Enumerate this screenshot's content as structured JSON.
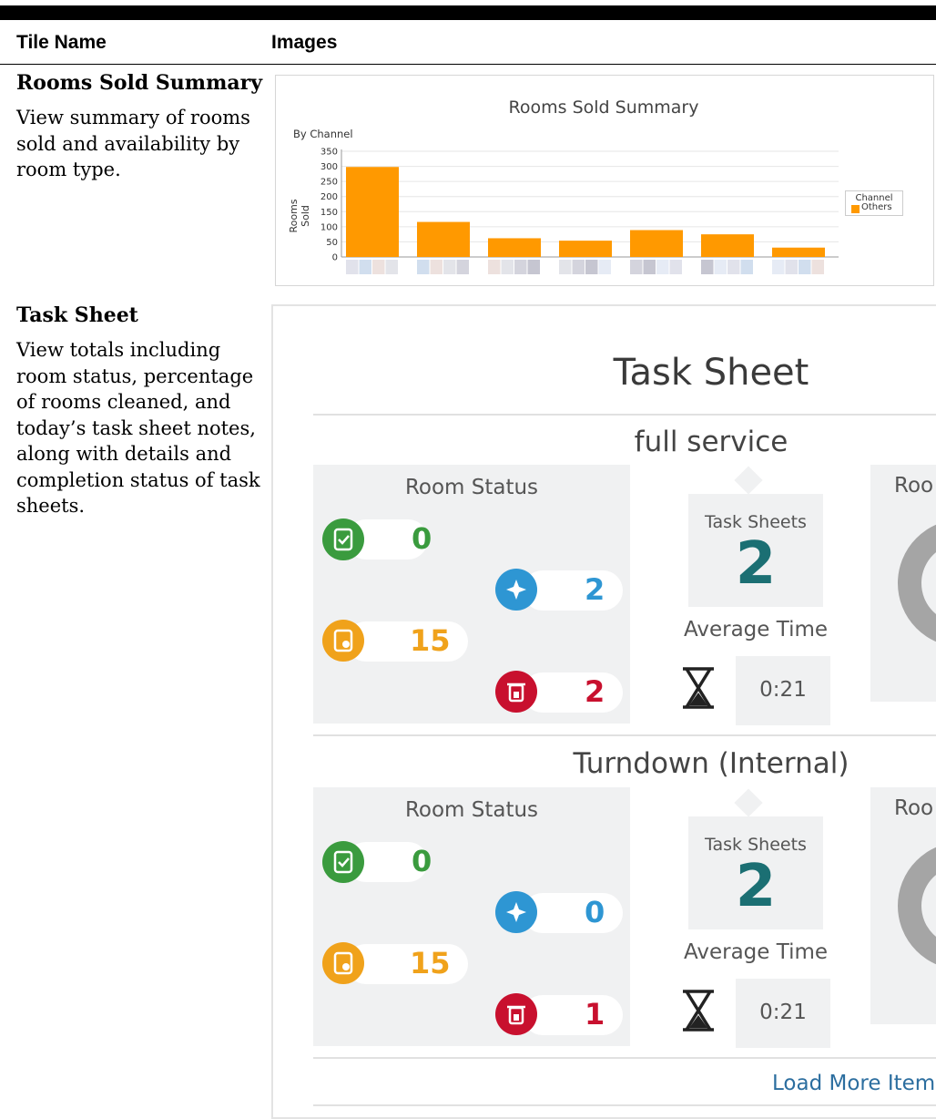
{
  "table": {
    "col_tile_name": "Tile Name",
    "col_images": "Images"
  },
  "rows": [
    {
      "name": "Rooms Sold Summary",
      "description": "View summary of rooms sold and availability by room type."
    },
    {
      "name": "Task Sheet",
      "description": "View totals including room status, percentage of rooms cleaned, and today’s task sheet notes, along with details and completion status of task sheets."
    }
  ],
  "chart_data": {
    "type": "bar",
    "title": "Rooms Sold Summary",
    "subtitle": "By Channel",
    "xlabel": "",
    "ylabel": "Rooms Sold",
    "categories": [
      "",
      "",
      "",
      "",
      "",
      "",
      ""
    ],
    "series": [
      {
        "name": "Others",
        "values": [
          298,
          116,
          62,
          54,
          89,
          75,
          31
        ]
      }
    ],
    "ylim": [
      0,
      350
    ],
    "yticks": [
      350,
      300,
      250,
      200,
      150,
      100,
      50,
      0
    ],
    "legend": {
      "title": "Channel",
      "placement": "right"
    },
    "grid": true,
    "colors": {
      "bar": "#ff9900"
    }
  },
  "task_sheet": {
    "title": "Task Sheet",
    "sections": [
      {
        "name": "full service",
        "room_status_label": "Room Status",
        "clean": "0",
        "inspected": "2",
        "dirty": "15",
        "out_of_order": "2",
        "task_sheets_label": "Task Sheets",
        "task_sheets": "2",
        "average_time_label": "Average Time",
        "average_time": "0:21",
        "right_label": "Roo"
      },
      {
        "name": "Turndown (Internal)",
        "room_status_label": "Room Status",
        "clean": "0",
        "inspected": "0",
        "dirty": "15",
        "out_of_order": "1",
        "task_sheets_label": "Task Sheets",
        "task_sheets": "2",
        "average_time_label": "Average Time",
        "average_time": "0:21",
        "right_label": "Roo"
      }
    ],
    "load_more": "Load More Item",
    "colors": {
      "clean": "#3a9b3e",
      "inspected": "#2e96d3",
      "dirty": "#f0a21b",
      "out_of_order": "#c8102e",
      "task_number": "#1b6f73"
    },
    "icons": [
      "clipboard-check-icon",
      "sparkle-icon",
      "clipboard-dirty-icon",
      "trash-icon",
      "hourglass-icon"
    ]
  }
}
